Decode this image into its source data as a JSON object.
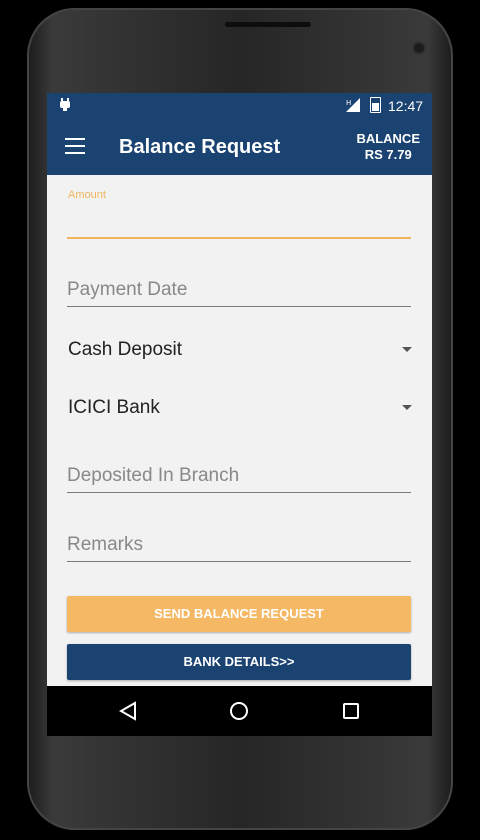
{
  "status_bar": {
    "time": "12:47",
    "signal_label": "H"
  },
  "app_bar": {
    "title": "Balance Request",
    "balance_label": "BALANCE",
    "balance_value": "RS 7.79"
  },
  "form": {
    "amount_label": "Amount",
    "amount_value": "",
    "payment_date_placeholder": "Payment Date",
    "payment_mode_selected": "Cash Deposit",
    "bank_selected": "ICICI Bank",
    "branch_placeholder": "Deposited In Branch",
    "remarks_placeholder": "Remarks"
  },
  "buttons": {
    "send": "SEND BALANCE REQUEST",
    "bank_details": "BANK DETAILS>>"
  },
  "colors": {
    "primary": "#1a4372",
    "accent": "#f5b865",
    "label_accent": "#f0b45e"
  },
  "icons": {
    "menu": "hamburger-menu-icon",
    "back": "back-triangle-icon",
    "home": "home-circle-icon",
    "recents": "recents-square-icon",
    "notification": "android-robot-icon"
  }
}
